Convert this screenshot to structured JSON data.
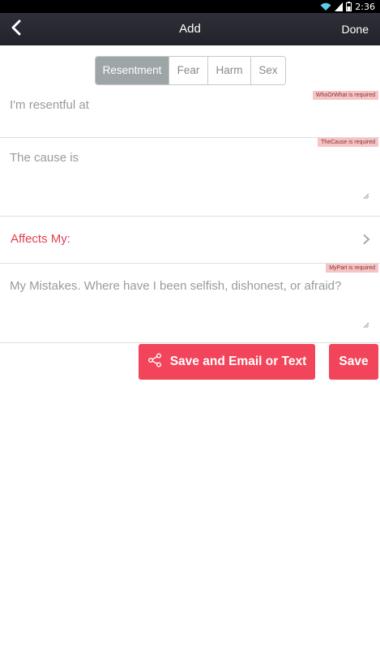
{
  "status_bar": {
    "time": "2:36"
  },
  "nav": {
    "title": "Add",
    "done_label": "Done"
  },
  "segments": [
    {
      "label": "Resentment",
      "active": true
    },
    {
      "label": "Fear",
      "active": false
    },
    {
      "label": "Harm",
      "active": false
    },
    {
      "label": "Sex",
      "active": false
    }
  ],
  "fields": {
    "who": {
      "placeholder": "I'm resentful at",
      "error": "WhoOrWhat is required"
    },
    "cause": {
      "placeholder": "The cause is",
      "error": "TheCause is required"
    },
    "affects": {
      "label": "Affects My:"
    },
    "mistakes": {
      "placeholder": "My Mistakes.  Where have I been selfish, dishonest, or afraid?",
      "error": "MyPart is required"
    }
  },
  "buttons": {
    "email_label": "Save and Email or Text",
    "save_label": "Save"
  },
  "colors": {
    "accent": "#f2445a",
    "accent_text": "#e2404f",
    "segment_active": "#9da5a6",
    "nav_bg": "#2e2f38",
    "error_bg": "#f5c5c5"
  }
}
